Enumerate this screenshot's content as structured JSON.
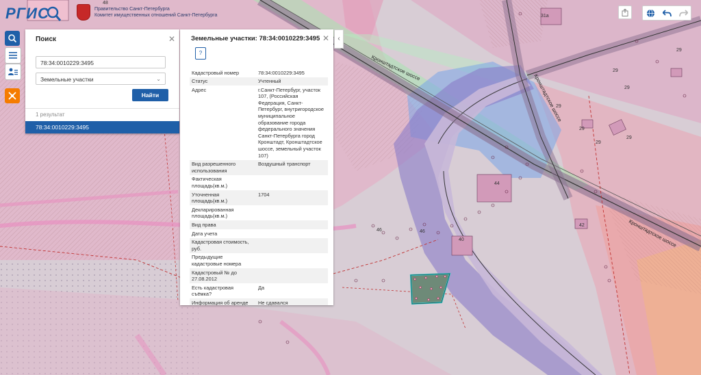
{
  "header": {
    "logo_text": "РГИС",
    "gov_line1": "Правительство Санкт-Петербурга",
    "gov_line2": "Комитет имущественных отношений Санкт-Петербурга"
  },
  "toolbar": {
    "search_icon": "search-icon",
    "menu_icon": "menu-icon",
    "user_icon": "user-list-icon",
    "tool_icon": "tools-icon"
  },
  "search": {
    "title": "Поиск",
    "query_value": "78:34:0010229:3495",
    "type_selected": "Земельные участки",
    "find_label": "Найти",
    "result_count": "1 результат",
    "result_item": "78:34:0010229:3495"
  },
  "info": {
    "title": "Земельные участки: 78:34:0010229:3495",
    "rows": [
      {
        "k": "Кадастровый номер",
        "v": "78:34:0010229:3495"
      },
      {
        "k": "Статус",
        "v": "Учтенный"
      },
      {
        "k": "Адрес",
        "v": "г.Санкт-Петербург, участок 107, (Российская Федерация, Санкт-Петербург, внутригородское муниципальное образование города федерального значения Санкт-Петербурга город Кронштадт, Кронштадтское шоссе, земельный участок 107)"
      },
      {
        "k": "Вид разрешенного использования",
        "v": "Воздушный транспорт"
      },
      {
        "k": "Фактическая площадь(кв.м.)",
        "v": ""
      },
      {
        "k": "Уточненная площадь(кв.м.)",
        "v": "1704"
      },
      {
        "k": "Декларированная площадь(кв.м.)",
        "v": ""
      },
      {
        "k": "Вид права",
        "v": ""
      },
      {
        "k": "Дата учета",
        "v": ""
      },
      {
        "k": "Кадастровая стоимость, руб.",
        "v": ""
      },
      {
        "k": "Предыдущие кадастровые номера",
        "v": ""
      },
      {
        "k": "Кадастровый № до 27.08.2012",
        "v": ""
      },
      {
        "k": "Есть кадастровая съёмка?",
        "v": "Да"
      },
      {
        "k": "Информация об аренде",
        "v": "Не сдавался"
      }
    ]
  },
  "map": {
    "road_label_1": "Кронштадтское шоссе",
    "road_label_2": "Кронштадтское шоссе",
    "road_label_3": "Кронштадтское шоссе",
    "labels": [
      "48",
      "31а",
      "29",
      "29",
      "29",
      "29",
      "29",
      "29",
      "29",
      "42",
      "44",
      "46",
      "46",
      "40"
    ]
  }
}
